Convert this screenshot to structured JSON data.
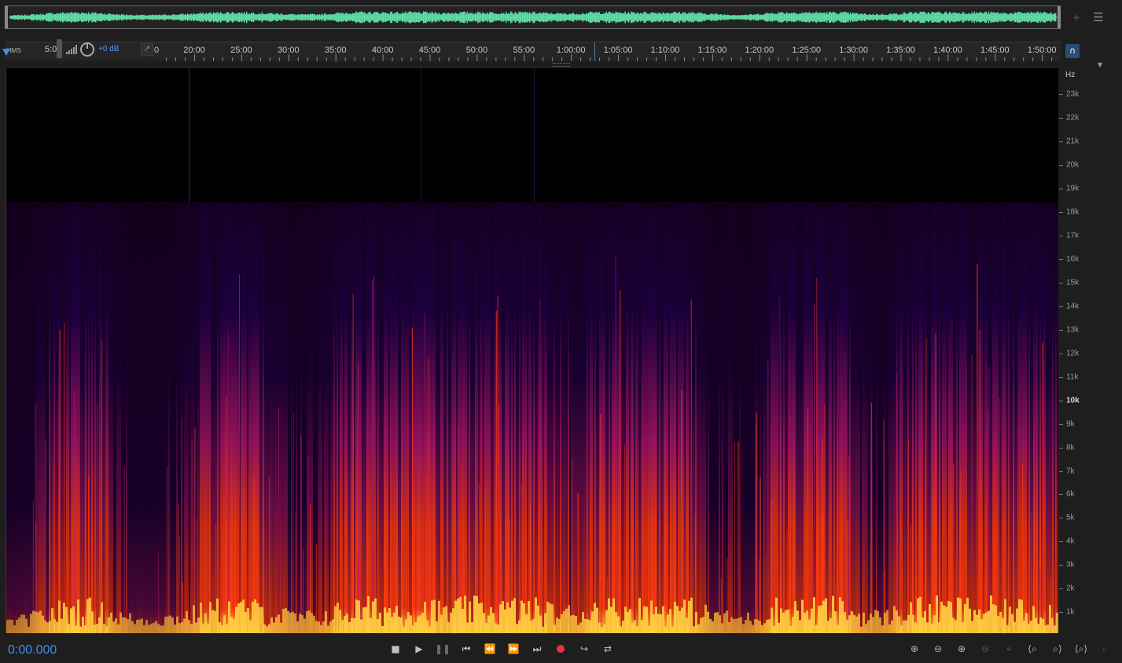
{
  "overview": {
    "waveform_color": "#5fe0a8",
    "icons": [
      "zoom-out-overview-icon",
      "panel-menu-icon"
    ]
  },
  "ruler": {
    "time_ticks": [
      "20:00",
      "25:00",
      "30:00",
      "35:00",
      "40:00",
      "45:00",
      "50:00",
      "55:00",
      "1:00:00",
      "1:05:00",
      "1:10:00",
      "1:15:00",
      "1:20:00",
      "1:25:00",
      "1:30:00",
      "1:35:00",
      "1:40:00",
      "1:45:00",
      "1:50:00"
    ],
    "hud": {
      "timecode_label": "HMS",
      "visible_time": "5:0",
      "gain_label": "+0 dB",
      "partial_tick": "0"
    }
  },
  "spectrogram": {
    "unit": "Hz",
    "freq_labels": [
      "23k",
      "22k",
      "21k",
      "20k",
      "19k",
      "18k",
      "17k",
      "16k",
      "15k",
      "14k",
      "13k",
      "12k",
      "11k",
      "10k",
      "9k",
      "8k",
      "7k",
      "6k",
      "5k",
      "4k",
      "3k",
      "2k",
      "1k"
    ],
    "bold_label": "10k",
    "colors": {
      "low": "#20004a",
      "mid": "#b0166b",
      "high": "#ff3a10",
      "peak": "#ffd040"
    }
  },
  "transport": {
    "current_time": "0:00.000",
    "record_color": "#e8343a",
    "accent_color": "#3d8ef0"
  }
}
